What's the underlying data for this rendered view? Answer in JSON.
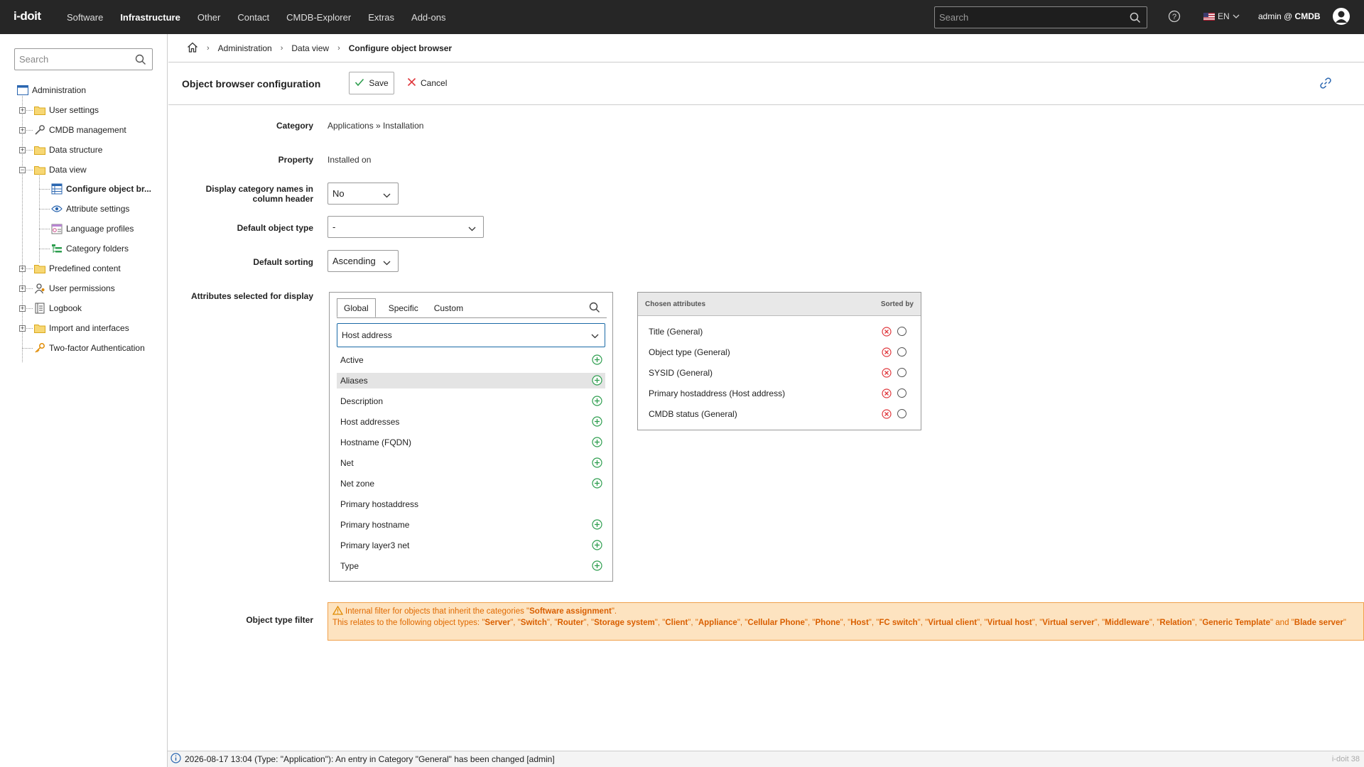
{
  "app": {
    "logo": "i-doit",
    "version": "i-doit 38"
  },
  "topnav": {
    "items": [
      "Software",
      "Infrastructure",
      "Other",
      "Contact",
      "CMDB-Explorer",
      "Extras",
      "Add-ons"
    ],
    "active": "Infrastructure"
  },
  "top": {
    "search_placeholder": "Search",
    "language": "EN",
    "user": "admin @",
    "tenant": "CMDB"
  },
  "sidebar": {
    "search_placeholder": "Search",
    "root": "Administration",
    "items": [
      {
        "label": "User settings"
      },
      {
        "label": "CMDB management"
      },
      {
        "label": "Data structure"
      },
      {
        "label": "Data view"
      },
      {
        "label": "Configure object br..."
      },
      {
        "label": "Attribute settings"
      },
      {
        "label": "Language profiles"
      },
      {
        "label": "Category folders"
      },
      {
        "label": "Predefined content"
      },
      {
        "label": "User permissions"
      },
      {
        "label": "Logbook"
      },
      {
        "label": "Import and interfaces"
      },
      {
        "label": "Two-factor Authentication"
      }
    ]
  },
  "breadcrumb": {
    "items": [
      "Administration",
      "Data view",
      "Configure object browser"
    ]
  },
  "toolbar": {
    "title": "Object browser configuration",
    "save_label": "Save",
    "cancel_label": "Cancel"
  },
  "form": {
    "category_label": "Category",
    "category_value": "Applications » Installation",
    "property_label": "Property",
    "property_value": "Installed on",
    "display_names_label": "Display category names in column header",
    "display_names_value": "No",
    "default_type_label": "Default object type",
    "default_type_value": "-",
    "default_sorting_label": "Default sorting",
    "default_sorting_value": "Ascending",
    "attributes_label": "Attributes selected for display",
    "filter_label": "Object type filter"
  },
  "attributes": {
    "tabs": [
      "Global",
      "Specific",
      "Custom"
    ],
    "active_tab": "Global",
    "selected_group": "Host address",
    "items": [
      {
        "label": "Active",
        "addable": true
      },
      {
        "label": "Aliases",
        "addable": true,
        "highlight": true
      },
      {
        "label": "Description",
        "addable": true
      },
      {
        "label": "Host addresses",
        "addable": true
      },
      {
        "label": "Hostname (FQDN)",
        "addable": true
      },
      {
        "label": "Net",
        "addable": true
      },
      {
        "label": "Net zone",
        "addable": true
      },
      {
        "label": "Primary hostaddress",
        "addable": false
      },
      {
        "label": "Primary hostname",
        "addable": true
      },
      {
        "label": "Primary layer3 net",
        "addable": true
      },
      {
        "label": "Type",
        "addable": true
      }
    ]
  },
  "chosen": {
    "header": "Chosen attributes",
    "sorted_by": "Sorted by",
    "items": [
      "Title (General)",
      "Object type (General)",
      "SYSID (General)",
      "Primary hostaddress (Host address)",
      "CMDB status (General)"
    ]
  },
  "notice": {
    "line1_prefix": "Internal filter for objects that inherit the categories \"",
    "line1_category": "Software assignment",
    "line1_suffix": "\".",
    "line2_prefix": "This relates to the following object types: ",
    "types": [
      "Server",
      "Switch",
      "Router",
      "Storage system",
      "Client",
      "Appliance",
      "Cellular Phone",
      "Phone",
      "Host",
      "FC switch",
      "Virtual client",
      "Virtual host",
      "Virtual server",
      "Middleware",
      "Relation",
      "Generic Template",
      "Blade server"
    ]
  },
  "status": {
    "message": "2026-08-17 13:04 (Type: \"Application\"): An entry in Category \"General\" has been changed [admin]"
  },
  "colors": {
    "topbar": "#262626",
    "accent_green": "#2e9e4f",
    "remove_red": "#e0393e",
    "notice_bg": "#fde3c0",
    "notice_text": "#e06a00"
  }
}
